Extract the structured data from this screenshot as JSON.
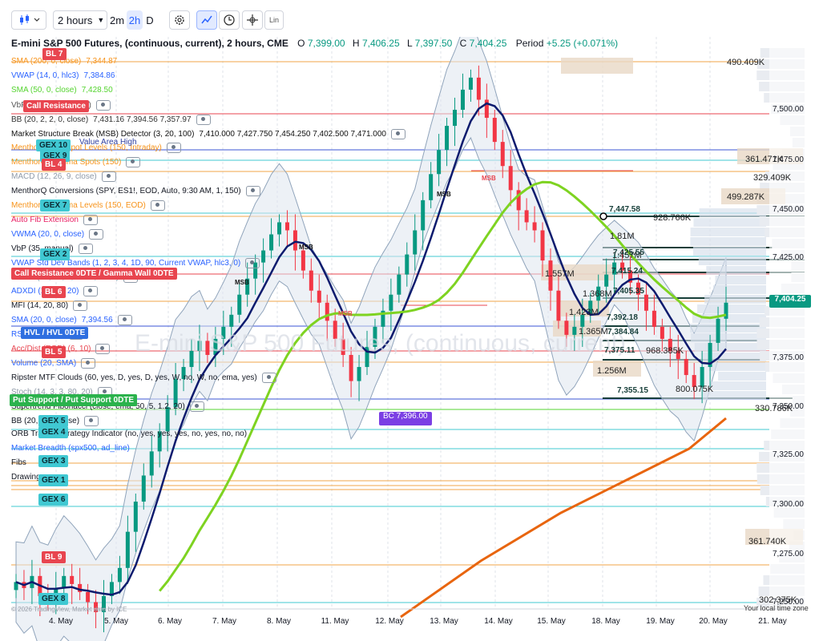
{
  "toolbar": {
    "interval": "2 hours",
    "quick": [
      "2m",
      "2h",
      "D"
    ],
    "active_quick": "2h",
    "lin_label": "Lin"
  },
  "header": {
    "title": "E-mini S&P 500 Futures, (continuous, current), 2 hours, CME",
    "o_label": "O",
    "o": "7,399.00",
    "h_label": "H",
    "h": "7,406.25",
    "l_label": "L",
    "l": "7,397.50",
    "c_label": "C",
    "c": "7,404.25",
    "period_label": "Period",
    "change": "+5.25 (+0.071%)"
  },
  "indicators": [
    {
      "name": "SMA (200, 0, close)",
      "value": "7,344.87",
      "color": "#f7931a"
    },
    {
      "name": "VWAP (14, 0, hlc3)",
      "value": "7,384.86",
      "color": "#2962ff"
    },
    {
      "name": "SMA (50, 0, close)",
      "value": "7,428.50",
      "color": "#55d430"
    },
    {
      "name": "VbP (Session Volume)",
      "value": "",
      "color": "#555555"
    },
    {
      "name": "BB (20, 2, 2, 0, close)",
      "value": "7,431.16  7,394.56  7,357.97",
      "color": "#333333"
    },
    {
      "name": "Market Structure Break (MSB) Detector (3, 20, 100)",
      "value": "7,410.000  7,427.750  7,454.250  7,402.500  7,471.000",
      "color": "#111111"
    },
    {
      "name": "MenthorQ Blindspot Levels (150, Intraday)",
      "value": "",
      "color": "#f7931a"
    },
    {
      "name": "MenthorQ Gamma Spots (150)",
      "value": "",
      "color": "#f7931a"
    },
    {
      "name": "MACD (12, 26, 9, close)",
      "value": "",
      "color": "#8f9aa8"
    },
    {
      "name": "MenthorQ Conversions (SPY, ES1!, EOD, Auto, 9:30 AM, 1, 150)",
      "value": "",
      "color": "#131722"
    },
    {
      "name": "MenthorQ Gamma Levels (150, EOD)",
      "value": "",
      "color": "#f7931a"
    },
    {
      "name": "Auto Fib Extension",
      "value": "",
      "color": "#e91e63"
    },
    {
      "name": "VWMA (20, 0, close)",
      "value": "",
      "color": "#2962ff"
    },
    {
      "name": "VbP (35, manual)",
      "value": "",
      "color": "#131722"
    },
    {
      "name": "VWAP Std Dev Bands (1, 2, 3, 4, 1D, 90, Current VWAP, hlc3, 0)",
      "value": "",
      "color": "#2962ff"
    },
    {
      "name": "MACD (12, 26, 9, close, EMA)",
      "value": "",
      "color": "#8f9aa8"
    },
    {
      "name": "ADXDI (14, 20, 20)",
      "value": "",
      "color": "#2962ff"
    },
    {
      "name": "MFI (14, 20, 80)",
      "value": "",
      "color": "#131722"
    },
    {
      "name": "SMA (20, 0, close)",
      "value": "7,394.56",
      "color": "#2962ff"
    },
    {
      "name": "RSI (14, close)",
      "value": "",
      "color": "#2962ff"
    },
    {
      "name": "Acc/Dist (EOD) (6, 10)",
      "value": "",
      "color": "#e8454f"
    },
    {
      "name": "Volume (20, SMA)",
      "value": "",
      "color": "#2962ff"
    },
    {
      "name": "Ripster MTF Clouds (60, yes, D, yes, D, yes, W, no, W, no, ema, yes)",
      "value": "",
      "color": "#131722"
    },
    {
      "name": "Stoch (14, 3, 3, 80, 20)",
      "value": "",
      "color": "#8f9aa8"
    },
    {
      "name": "Supertrend Fibonacci (close, ema, 50, 5, 1.2, 20)",
      "value": "",
      "color": "#131722"
    },
    {
      "name": "BB (20, 2, 0, close)",
      "value": "",
      "color": "#131722"
    },
    {
      "name": "ORB Trading Strategy Indicator (no, yes, yes, yes, no, yes, no, no)",
      "value": "",
      "color": "#131722"
    },
    {
      "name": "Market Breadth (spx500, ad_line)",
      "value": "",
      "color": "#2962ff"
    },
    {
      "name": "Fibs",
      "value": "",
      "color": "#131722"
    },
    {
      "name": "Drawings",
      "value": "",
      "color": "#131722"
    }
  ],
  "tags": [
    {
      "text": "BL 7",
      "kind": "bl"
    },
    {
      "text": "Call Resistance",
      "kind": "bl"
    },
    {
      "text": "GEX 9",
      "kind": "gex"
    },
    {
      "text": "GEX 10",
      "kind": "gex"
    },
    {
      "text": "BL 4",
      "kind": "bl"
    },
    {
      "text": "GEX 7",
      "kind": "gex"
    },
    {
      "text": "GEX 2",
      "kind": "gex"
    },
    {
      "text": "Call Resistance 0DTE / Gamma Wall 0DTE",
      "kind": "bl"
    },
    {
      "text": "BL 6",
      "kind": "bl"
    },
    {
      "text": "HVL / HVL 0DTE",
      "kind": "blue"
    },
    {
      "text": "BL 5",
      "kind": "bl"
    },
    {
      "text": "Put Support / Put Support 0DTE",
      "kind": "green"
    },
    {
      "text": "GEX 5",
      "kind": "gex"
    },
    {
      "text": "GEX 4",
      "kind": "gex"
    },
    {
      "text": "GEX 3",
      "kind": "gex"
    },
    {
      "text": "GEX 1",
      "kind": "gex"
    },
    {
      "text": "GEX 6",
      "kind": "gex"
    },
    {
      "text": "BL 9",
      "kind": "bl"
    },
    {
      "text": "GEX 8",
      "kind": "gex"
    }
  ],
  "value_area_high_label": "Value Area High",
  "msb_labels": [
    "MSB",
    "MSB",
    "MSB",
    "MSB",
    "MSB"
  ],
  "volume_profile_labels": [
    "490.409K",
    "361.471K",
    "329.409K",
    "499.287K",
    "928.766K",
    "1.81M",
    "1.457M",
    "1.557M",
    "1.368M",
    "1.423M",
    "1.365M",
    "968.385K",
    "1.256M",
    "800.075K",
    "330.786K",
    "361.740K",
    "302.375K"
  ],
  "level_labels": [
    "7,447.58",
    "7,425.55",
    "7,415.24",
    "7,405.35",
    "7,392.18",
    "7,384.84",
    "7,375.11",
    "7,355.15"
  ],
  "bc_label": "BC 7,396.00",
  "price_axis": {
    "ticks": [
      "7,500.00",
      "7,475.00",
      "7,450.00",
      "7,425.00",
      "7,375.00",
      "7,350.00",
      "7,325.00",
      "7,300.00",
      "7,275.00",
      "7,250.00"
    ],
    "current_price": "7,404.25",
    "current_price_color": "#089981"
  },
  "time_axis": {
    "ticks": [
      "4. May",
      "5. May",
      "6. May",
      "7. May",
      "8. May",
      "11. May",
      "12. May",
      "13. May",
      "14. May",
      "15. May",
      "18. May",
      "19. May",
      "20. May",
      "21. May"
    ],
    "timezone_label": "Your local time zone",
    "copyright": "© 2026 TradingView, Market data by ICE"
  },
  "watermark": "E-mini S&P 500 Futures, (continuous, current)",
  "colors": {
    "up": "#089981",
    "down": "#f23645",
    "sma200": "#e8650f",
    "sma50": "#7ed321",
    "vwap": "#0d1b6e",
    "band": "#c8d3e0"
  },
  "chart_data": {
    "type": "candlestick",
    "title": "E-mini S&P 500 Futures, (continuous, current), 2 hours, CME",
    "ylim": [
      7240,
      7520
    ],
    "series_close": [
      7265,
      7262,
      7268,
      7258,
      7255,
      7262,
      7268,
      7264,
      7260,
      7255,
      7250,
      7258,
      7265,
      7272,
      7290,
      7305,
      7318,
      7330,
      7340,
      7352,
      7366,
      7372,
      7380,
      7385,
      7378,
      7386,
      7392,
      7398,
      7408,
      7416,
      7424,
      7430,
      7438,
      7444,
      7440,
      7430,
      7420,
      7410,
      7404,
      7395,
      7386,
      7378,
      7365,
      7372,
      7382,
      7392,
      7400,
      7408,
      7418,
      7428,
      7440,
      7455,
      7468,
      7480,
      7492,
      7500,
      7510,
      7516,
      7505,
      7496,
      7484,
      7472,
      7460,
      7450,
      7444,
      7440,
      7425,
      7410,
      7395,
      7388,
      7392,
      7398,
      7405,
      7412,
      7418,
      7424,
      7420,
      7414,
      7408,
      7400,
      7392,
      7386,
      7380,
      7376,
      7368,
      7362,
      7372,
      7384,
      7396,
      7404
    ]
  }
}
